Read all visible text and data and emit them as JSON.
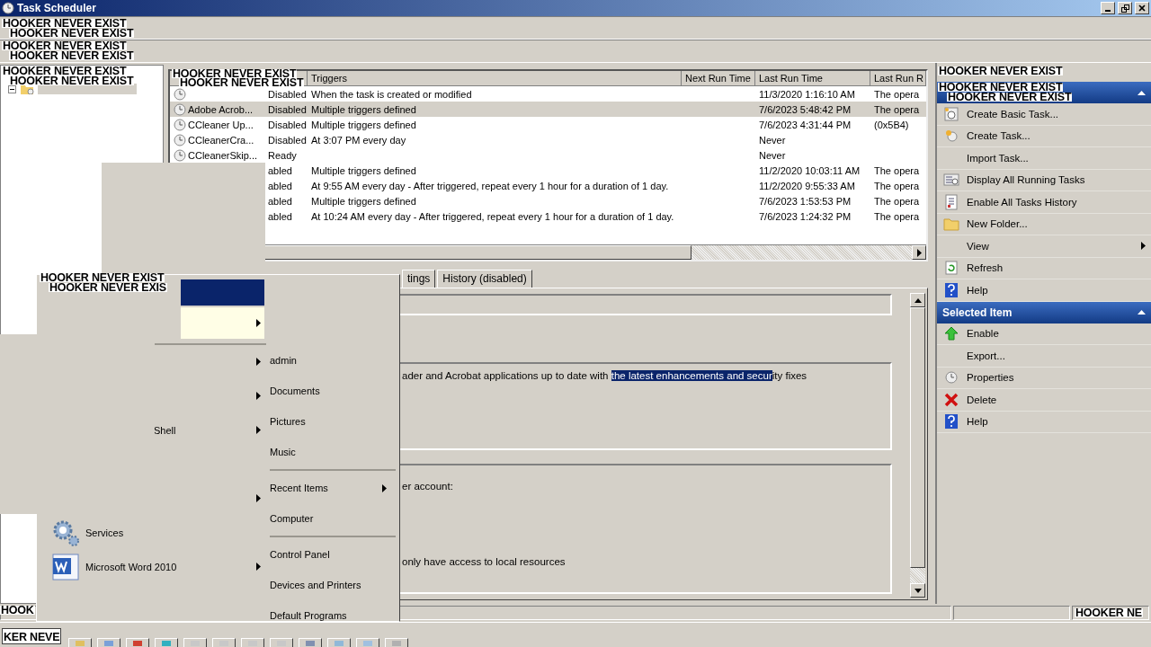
{
  "window": {
    "title": "Task Scheduler"
  },
  "overlay_labels": [
    {
      "text": "HOOKER NEVER EXIST"
    },
    {
      "text": "HOOKER NEVER EXIST"
    },
    {
      "text": "HOOKER NEVER EXIST"
    },
    {
      "text": "HOOKER NEVER EXIST"
    },
    {
      "text": "HOOKER NEVER EXIST"
    },
    {
      "text": "HOOKER NEVER EXIST"
    },
    {
      "text": "HOOKER NEVER EXIST"
    },
    {
      "text": "HOOKER NEVER EXIST"
    },
    {
      "text": "HOOKER NEVER EXIST"
    },
    {
      "text": "HOOKER NEVER EXIST"
    },
    {
      "text": "HOOKER NEVER EXIST"
    },
    {
      "text": "HOOKER NEVER EXIST"
    },
    {
      "text": "HOOKER NEVER EXIS"
    },
    {
      "text": "HOOK"
    },
    {
      "text": "KER NEVE"
    },
    {
      "text": "HOOKER NE"
    }
  ],
  "task_table": {
    "columns": [
      "Triggers",
      "Next Run Time",
      "Last Run Time",
      "Last Run R"
    ],
    "rows": [
      {
        "kind": "task",
        "status": "Disabled",
        "triggers": "When the task is created or modified",
        "last_run": "11/3/2020 1:16:10 AM",
        "result": "The opera",
        "selected": false
      },
      {
        "kind": "task",
        "name": "Adobe Acrob...",
        "status": "Disabled",
        "triggers": "Multiple triggers defined",
        "last_run": "7/6/2023 5:48:42 PM",
        "result": "The opera",
        "selected": true
      },
      {
        "kind": "task",
        "name": "CCleaner Up...",
        "status": "Disabled",
        "triggers": "Multiple triggers defined",
        "last_run": "7/6/2023 4:31:44 PM",
        "result": "(0x5B4)",
        "selected": false
      },
      {
        "kind": "task",
        "name": "CCleanerCra...",
        "status": "Disabled",
        "triggers": "At 3:07 PM every day",
        "last_run": "Never",
        "selected": false
      },
      {
        "kind": "task",
        "name": "CCleanerSkip...",
        "status": "Ready",
        "last_run": "Never",
        "selected": false
      },
      {
        "kind": "covered",
        "status": "abled",
        "triggers": "Multiple triggers defined",
        "last_run": "11/2/2020 10:03:11 AM",
        "result": "The opera",
        "selected": false
      },
      {
        "kind": "covered",
        "status": "abled",
        "triggers": "At 9:55 AM every day - After triggered, repeat every 1 hour for a duration of 1 day.",
        "last_run": "11/2/2020 9:55:33 AM",
        "result": "The opera",
        "selected": false
      },
      {
        "kind": "covered",
        "status": "abled",
        "triggers": "Multiple triggers defined",
        "last_run": "7/6/2023 1:53:53 PM",
        "result": "The opera",
        "selected": false
      },
      {
        "kind": "covered",
        "status": "abled",
        "triggers": "At 10:24 AM every day - After triggered, repeat every 1 hour for a duration of 1 day.",
        "last_run": "7/6/2023 1:24:32 PM",
        "result": "The opera",
        "selected": false
      }
    ]
  },
  "detail_tabs": [
    {
      "label": "tings"
    },
    {
      "label": "History (disabled)"
    }
  ],
  "description": {
    "before": "ader and Acrobat applications up to date with",
    "highlight": "the latest enhancements and secur",
    "after": "ity fixes"
  },
  "security_lines": [
    "er account:",
    "only have access to local resources"
  ],
  "actions": [
    {
      "items": [
        {
          "label": "Create Basic Task..."
        },
        {
          "label": "Create Task..."
        },
        {
          "label": "Import Task..."
        },
        {
          "label": "Display All Running Tasks"
        },
        {
          "label": "Enable All Tasks History"
        },
        {
          "label": "New Folder..."
        },
        {
          "label": "View",
          "submenu": true
        },
        {
          "label": "Refresh"
        },
        {
          "label": "Help"
        }
      ]
    },
    {
      "title": "Selected Item",
      "items": [
        {
          "label": "Enable"
        },
        {
          "label": "Export..."
        },
        {
          "label": "Properties"
        },
        {
          "label": "Delete"
        },
        {
          "label": "Help"
        }
      ]
    }
  ],
  "start_menu": {
    "pinned": [
      {
        "selected": true,
        "submenu": false
      },
      {
        "selected": false,
        "submenu": true
      }
    ],
    "entries": [
      {
        "kind": "blank",
        "submenu": true
      },
      {
        "kind": "blank",
        "submenu": true
      },
      {
        "kind": "cut",
        "label": "Shell",
        "submenu": true
      },
      {
        "kind": "blank"
      },
      {
        "kind": "blank",
        "submenu": true
      },
      {
        "kind": "app",
        "label": "Services",
        "submenu": false
      },
      {
        "kind": "app",
        "label": "Microsoft Word 2010",
        "submenu": true
      }
    ],
    "right_groups": [
      [
        {
          "label": "admin"
        },
        {
          "label": "Documents"
        },
        {
          "label": "Pictures"
        },
        {
          "label": "Music"
        }
      ],
      [
        {
          "label": "Recent Items",
          "submenu": true
        },
        {
          "label": "Computer"
        }
      ],
      [
        {
          "label": "Control Panel"
        },
        {
          "label": "Devices and Printers"
        },
        {
          "label": "Default Programs"
        }
      ]
    ]
  }
}
